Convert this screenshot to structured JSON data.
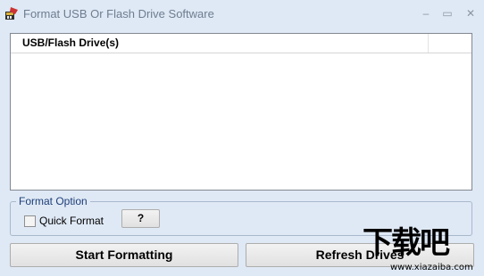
{
  "window": {
    "title": "Format USB Or Flash Drive Software",
    "icon": "usb-format-app-icon",
    "controls": {
      "minimize": "–",
      "maximize": "▭",
      "close": "✕"
    }
  },
  "drive_list": {
    "column_header": "USB/Flash Drive(s)",
    "rows": []
  },
  "format_option": {
    "legend": "Format Option",
    "quick_format_label": "Quick Format",
    "quick_format_checked": false,
    "help_label": "?"
  },
  "actions": {
    "start_label": "Start Formatting",
    "refresh_label": "Refresh Drives"
  },
  "watermark": {
    "mark": "下载吧",
    "url": "www.xiazaiba.com"
  }
}
